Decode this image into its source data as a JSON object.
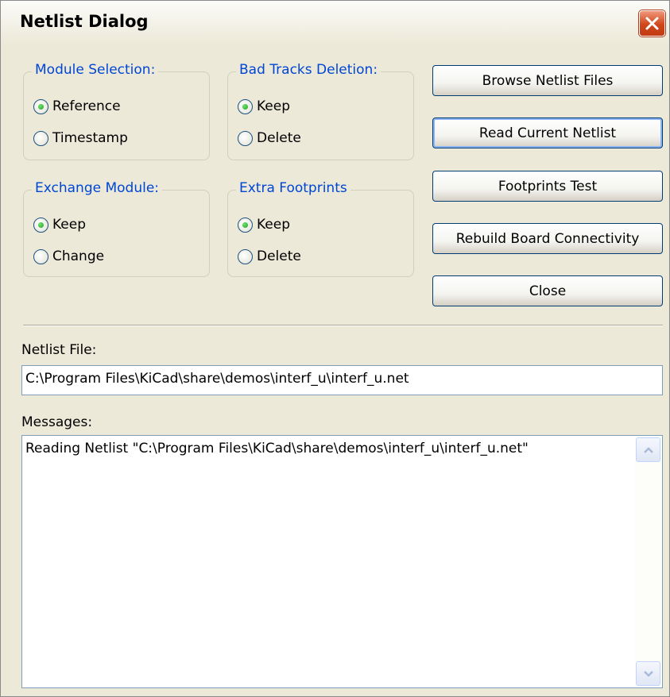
{
  "window": {
    "title": "Netlist Dialog"
  },
  "module_selection": {
    "legend": "Module Selection:",
    "options": [
      {
        "label": "Reference",
        "checked": true
      },
      {
        "label": "Timestamp",
        "checked": false
      }
    ]
  },
  "bad_tracks_deletion": {
    "legend": "Bad Tracks Deletion:",
    "options": [
      {
        "label": "Keep",
        "checked": true
      },
      {
        "label": "Delete",
        "checked": false
      }
    ]
  },
  "exchange_module": {
    "legend": "Exchange Module:",
    "options": [
      {
        "label": "Keep",
        "checked": true
      },
      {
        "label": "Change",
        "checked": false
      }
    ]
  },
  "extra_footprints": {
    "legend": "Extra Footprints",
    "options": [
      {
        "label": "Keep",
        "checked": true
      },
      {
        "label": "Delete",
        "checked": false
      }
    ]
  },
  "buttons": {
    "browse": "Browse Netlist Files",
    "read": "Read Current Netlist",
    "footprints_test": "Footprints Test",
    "rebuild": "Rebuild Board Connectivity",
    "close": "Close"
  },
  "netlist_file": {
    "label": "Netlist File:",
    "value": "C:\\Program Files\\KiCad\\share\\demos\\interf_u\\interf_u.net"
  },
  "messages": {
    "label": "Messages:",
    "text": "Reading Netlist \"C:\\Program Files\\KiCad\\share\\demos\\interf_u\\interf_u.net\""
  },
  "colors": {
    "dialog_bg": "#ece9d8",
    "legend_text": "#0046d5",
    "close_button": "#d0461c",
    "radio_dot": "#21a121"
  },
  "icons": [
    "close-icon",
    "scroll-up-arrow-icon",
    "scroll-down-arrow-icon"
  ]
}
